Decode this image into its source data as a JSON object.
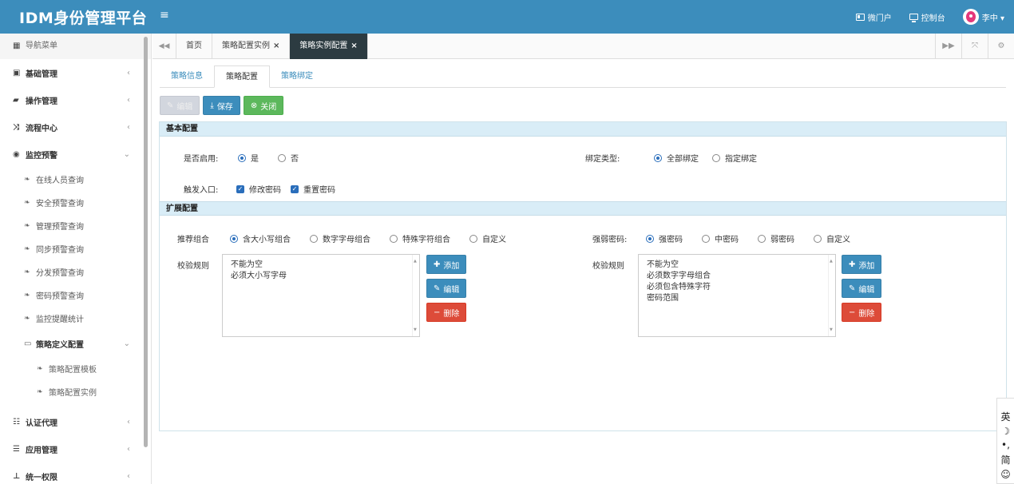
{
  "header": {
    "brand": "IDM身份管理平台",
    "items": [
      {
        "label": "微门户",
        "icon": "id-card-icon"
      },
      {
        "label": "控制台",
        "icon": "monitor-icon"
      }
    ],
    "user": "李中 ▾"
  },
  "sidebar": {
    "title": "导航菜单",
    "groups": [
      {
        "label": "基础管理"
      },
      {
        "label": "操作管理"
      },
      {
        "label": "流程中心"
      },
      {
        "label": "监控预警"
      }
    ],
    "monitor_items": [
      "在线人员查询",
      "安全预警查询",
      "管理预警查询",
      "同步预警查询",
      "分发预警查询",
      "密码预警查询",
      "监控提醒统计"
    ],
    "policy_folder": "策略定义配置",
    "policy_items": [
      "策略配置模板",
      "策略配置实例"
    ],
    "bottom_groups": [
      {
        "label": "认证代理"
      },
      {
        "label": "应用管理"
      },
      {
        "label": "统一权限"
      }
    ]
  },
  "tabs": {
    "home": "首页",
    "items": [
      {
        "label": "策略配置实例"
      },
      {
        "label": "策略实例配置"
      }
    ]
  },
  "subtabs": [
    "策略信息",
    "策略配置",
    "策略绑定"
  ],
  "toolbar": {
    "edit": "编辑",
    "save": "保存",
    "close": "关闭"
  },
  "basic": {
    "title": "基本配置",
    "enable_label": "是否启用:",
    "enable_yes": "是",
    "enable_no": "否",
    "bind_label": "绑定类型:",
    "bind_all": "全部绑定",
    "bind_some": "指定绑定",
    "entry_label": "触发入口:",
    "entry_change": "修改密码",
    "entry_reset": "重置密码"
  },
  "ext": {
    "title": "扩展配置",
    "combo_label": "推荐组合",
    "combo_opts": [
      "含大小写组合",
      "数字字母组合",
      "特殊字符组合",
      "自定义"
    ],
    "strength_label": "强弱密码:",
    "strength_opts": [
      "强密码",
      "中密码",
      "弱密码",
      "自定义"
    ],
    "rules_label_left": "校验规则",
    "rules_label_right": "校验规则",
    "rules_left": [
      "不能为空",
      "必须大小写字母"
    ],
    "rules_right": [
      "不能为空",
      "必须数字字母组合",
      "必须包含特殊字符",
      "密码范围"
    ],
    "btn_add": "添加",
    "btn_edit": "编辑",
    "btn_delete": "删除"
  },
  "ime": {
    "lang": "英",
    "moon": "☽",
    "punct": "•,",
    "mode": "简",
    "emoji": "☺"
  },
  "colors": {
    "header": "#3c8dbc",
    "active_tab": "#2c3b41",
    "section": "#d9edf7",
    "primary": "#3c8dbc",
    "success": "#5cb85c",
    "danger": "#dd4b39"
  }
}
